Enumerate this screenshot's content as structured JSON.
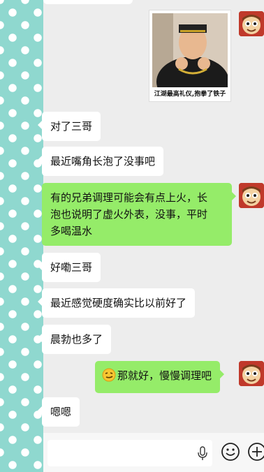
{
  "sticker": {
    "caption": "江湖最高礼仪,抱拳了铁子"
  },
  "messages": [
    {
      "side": "in",
      "text": "对了三哥"
    },
    {
      "side": "in",
      "text": "最近嘴角长泡了没事吧"
    },
    {
      "side": "out",
      "lines": [
        "有的兄弟调理可能会有点上火，长",
        "泡也说明了虚火外表，没事，平时",
        "多喝温水"
      ]
    },
    {
      "side": "in",
      "text": "好嘞三哥"
    },
    {
      "side": "in",
      "text": "最近感觉硬度确实比以前好了"
    },
    {
      "side": "in",
      "text": "晨勃也多了"
    },
    {
      "side": "out",
      "text": "那就好，慢慢调理吧",
      "emoji": "smirk-face-emoji"
    },
    {
      "side": "in",
      "text": "嗯嗯"
    }
  ],
  "icons": {
    "mic": "microphone-icon",
    "emoji": "smile-icon",
    "plus": "plus-icon"
  },
  "colors": {
    "incoming_bubble": "#ffffff",
    "outgoing_bubble": "#95ec69",
    "background": "#ededed",
    "polka_bg": "#8fd8cf"
  }
}
